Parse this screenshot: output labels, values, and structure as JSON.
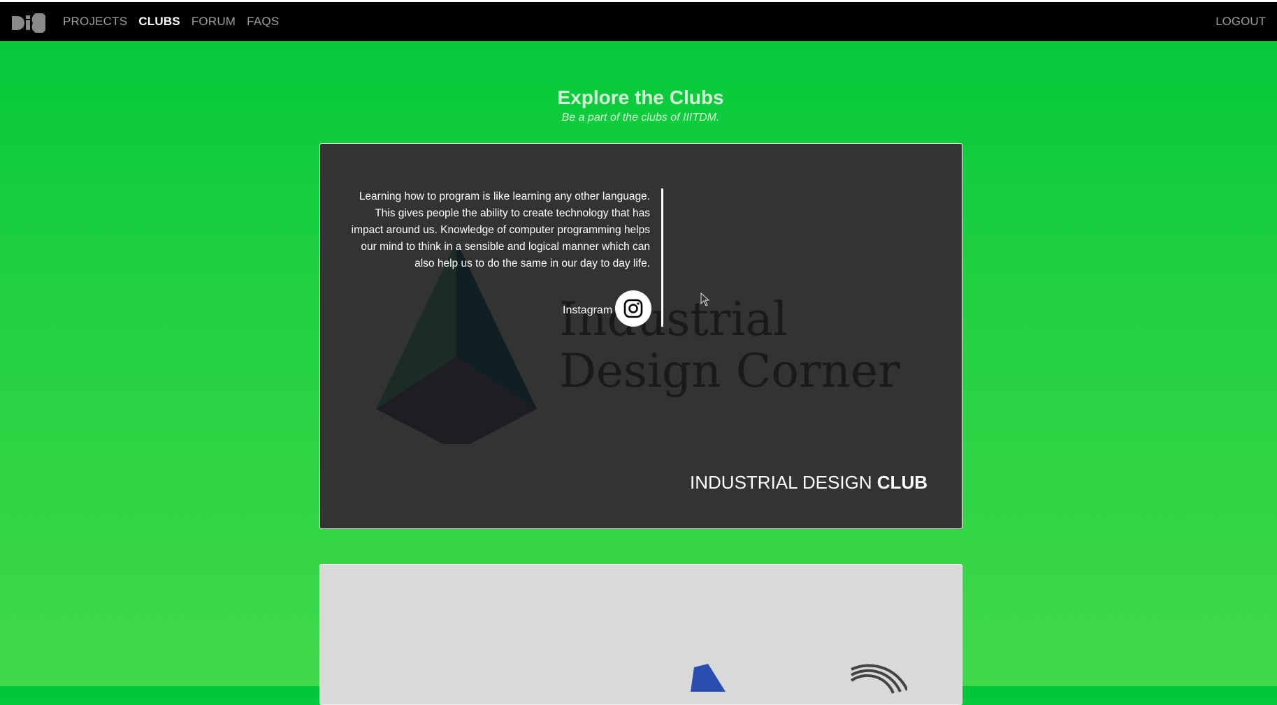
{
  "nav": {
    "logo_alt": "DiC",
    "links": [
      "PROJECTS",
      "CLUBS",
      "FORUM",
      "FAQS"
    ],
    "active": "CLUBS",
    "logout": "LOGOUT"
  },
  "page": {
    "title": "Explore the Clubs",
    "subtitle": "Be a part of the clubs of IIITDM."
  },
  "clubs": [
    {
      "description": "Learning how to program is like learning any other language. This gives people the ability to create technology that has impact around us. Knowledge of computer programming helps our mind to think in a sensible and logical manner which can also help us to do the same in our day to day life.",
      "instagram_label": "Instagram",
      "logo_text_line1": "Industrial",
      "logo_text_line2": "Design Corner",
      "name_regular": "INDUSTRIAL DESIGN",
      "name_bold": "CLUB"
    }
  ],
  "colors": {
    "nav_bg": "#000000",
    "card_bg": "#333333",
    "page_gradient_top": "#00c83a",
    "page_gradient_bottom": "#41d94a"
  },
  "icons": [
    "dic-logo-icon",
    "instagram-icon",
    "mouse-cursor-icon"
  ]
}
